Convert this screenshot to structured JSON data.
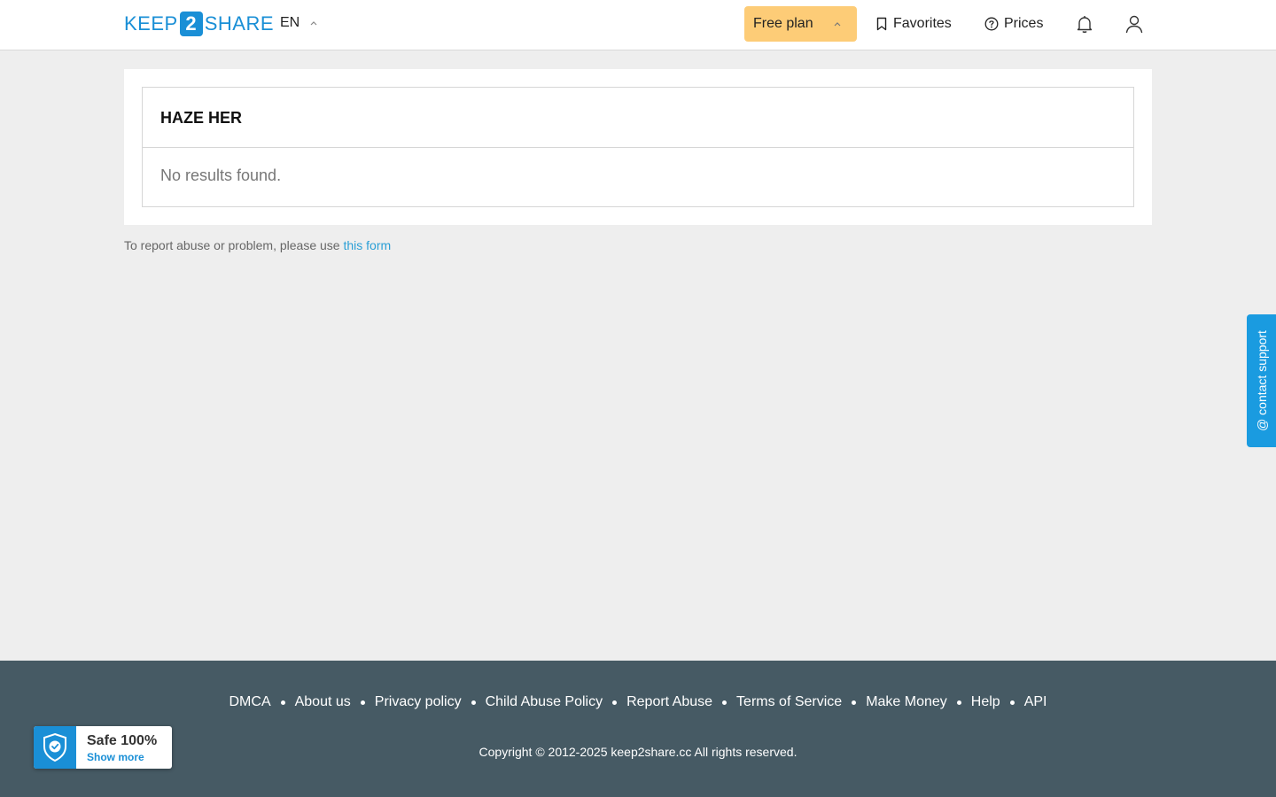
{
  "header": {
    "logo_pre": "KEEP",
    "logo_num": "2",
    "logo_post": "SHARE",
    "language": "EN",
    "plan_label": "Free plan",
    "favorites_label": "Favorites",
    "prices_label": "Prices"
  },
  "main": {
    "title": "HAZE HER",
    "empty_message": "No results found.",
    "report_text": "To report abuse or problem, please use",
    "report_link": "this form"
  },
  "support_tab": {
    "label": "@ contact support"
  },
  "footer": {
    "links": [
      "DMCA",
      "About us",
      "Privacy policy",
      "Child Abuse Policy",
      "Report Abuse",
      "Terms of Service",
      "Make Money",
      "Help",
      "API"
    ],
    "copyright": "Copyright © 2012-2025 keep2share.cc All rights reserved."
  },
  "safe_badge": {
    "title": "Safe 100%",
    "link": "Show more"
  },
  "colors": {
    "brand": "#1a8fd6",
    "plan_button": "#fdcc77",
    "footer_bg": "#465a64",
    "page_bg": "#eeeeee"
  }
}
